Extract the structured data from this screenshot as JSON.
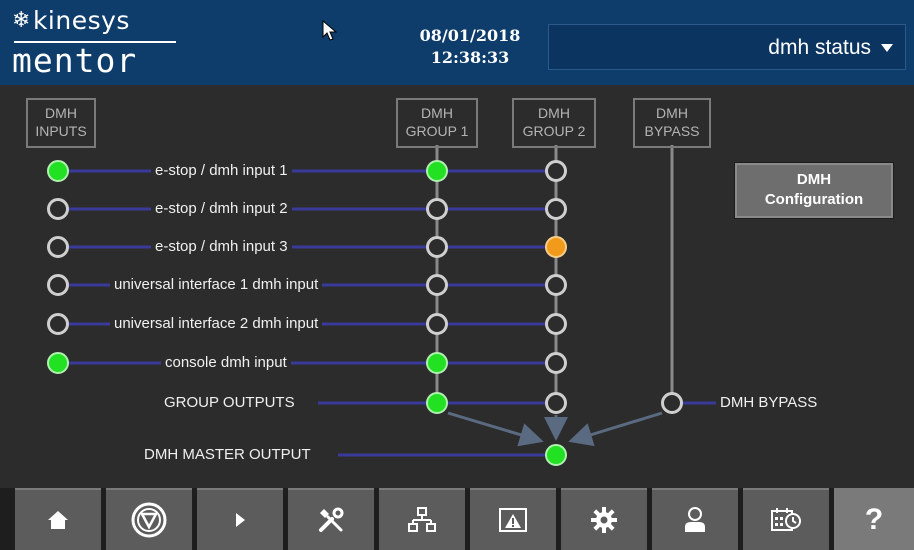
{
  "header": {
    "brand_top": "kinesys",
    "brand_bottom": "mentor",
    "date": "08/01/2018",
    "time": "12:38:33",
    "view_selector": {
      "selected": "dmh status"
    }
  },
  "columns": {
    "inputs": [
      "DMH",
      "INPUTS"
    ],
    "group1": [
      "DMH",
      "GROUP 1"
    ],
    "group2": [
      "DMH",
      "GROUP 2"
    ],
    "bypass": [
      "DMH",
      "BYPASS"
    ]
  },
  "rows": [
    {
      "label": "e-stop / dmh input 1",
      "input": "green",
      "group1": "green",
      "group2": "off"
    },
    {
      "label": "e-stop / dmh input 2",
      "input": "off",
      "group1": "off",
      "group2": "off"
    },
    {
      "label": "e-stop / dmh input 3",
      "input": "off",
      "group1": "off",
      "group2": "orange"
    },
    {
      "label": "universal interface 1 dmh input",
      "input": "off",
      "group1": "off",
      "group2": "off"
    },
    {
      "label": "universal interface 2 dmh input",
      "input": "off",
      "group1": "off",
      "group2": "off"
    },
    {
      "label": "console dmh input",
      "input": "green",
      "group1": "green",
      "group2": "off"
    }
  ],
  "group_outputs": {
    "label": "GROUP OUTPUTS",
    "group1": "green",
    "group2": "off"
  },
  "bypass_output": {
    "label": "DMH BYPASS",
    "state": "off"
  },
  "master_output": {
    "label": "DMH MASTER OUTPUT",
    "state": "green"
  },
  "config_button": {
    "line1": "DMH",
    "line2": "Configuration"
  },
  "colors": {
    "header_bg": "#0f3d6b",
    "on": "#22e022",
    "warning": "#f29a1a",
    "line": "#3a3a9a"
  },
  "nav": [
    {
      "icon": "home-icon",
      "active": false
    },
    {
      "icon": "emergency-stop-icon",
      "active": false
    },
    {
      "icon": "play-icon",
      "active": false
    },
    {
      "icon": "tools-icon",
      "active": false
    },
    {
      "icon": "network-icon",
      "active": false
    },
    {
      "icon": "warning-window-icon",
      "active": false
    },
    {
      "icon": "gear-icon",
      "active": false
    },
    {
      "icon": "user-icon",
      "active": false
    },
    {
      "icon": "schedule-icon",
      "active": false
    },
    {
      "icon": "help-icon",
      "glyph": "?",
      "active": true
    }
  ]
}
